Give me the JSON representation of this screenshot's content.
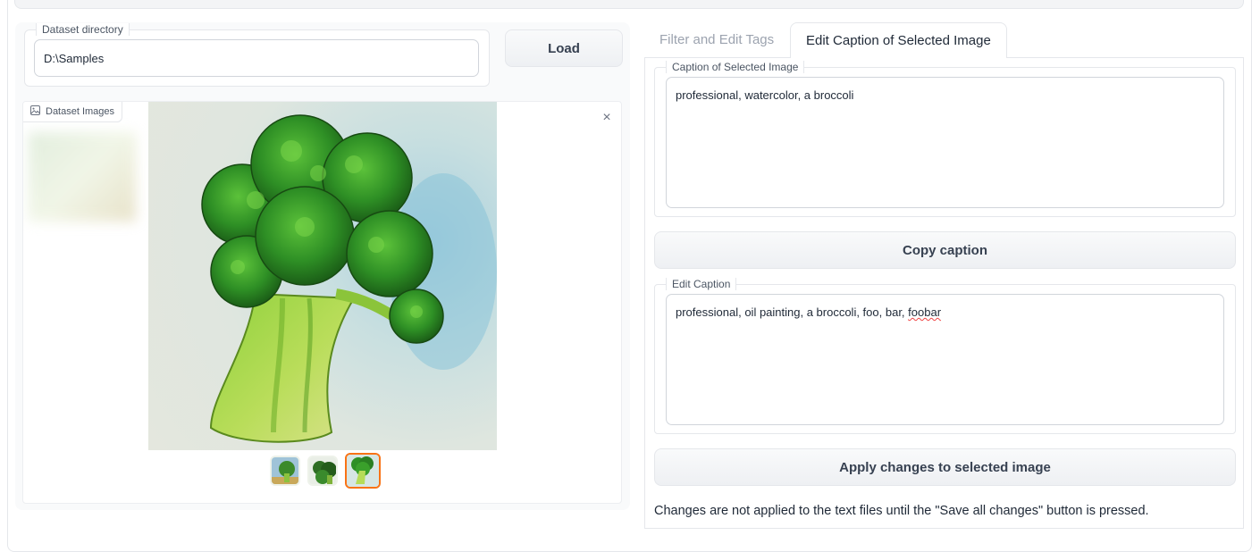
{
  "dataset": {
    "directory_label": "Dataset directory",
    "directory_value": "D:\\Samples",
    "load_label": "Load"
  },
  "gallery": {
    "label": "Dataset Images",
    "close_symbol": "×",
    "selected_index": 3,
    "thumbnail_count": 3
  },
  "tabs": [
    {
      "label": "Filter and Edit Tags",
      "active": false
    },
    {
      "label": "Edit Caption of Selected Image",
      "active": true
    }
  ],
  "caption": {
    "label": "Caption of Selected Image",
    "value": "professional, watercolor, a broccoli"
  },
  "copy_button": "Copy caption",
  "edit": {
    "label": "Edit Caption",
    "value_before": "professional, oil painting, a broccoli, foo, bar, ",
    "value_misspelled": "foobar"
  },
  "apply_button": "Apply changes to selected image",
  "note": "Changes are not applied to the text files until the \"Save all changes\" button is pressed.",
  "colors": {
    "accent_selected": "#f97316",
    "broccoli_dark": "#1f7a1f",
    "broccoli_light": "#a6d64a",
    "spellcheck": "#ef4444"
  }
}
